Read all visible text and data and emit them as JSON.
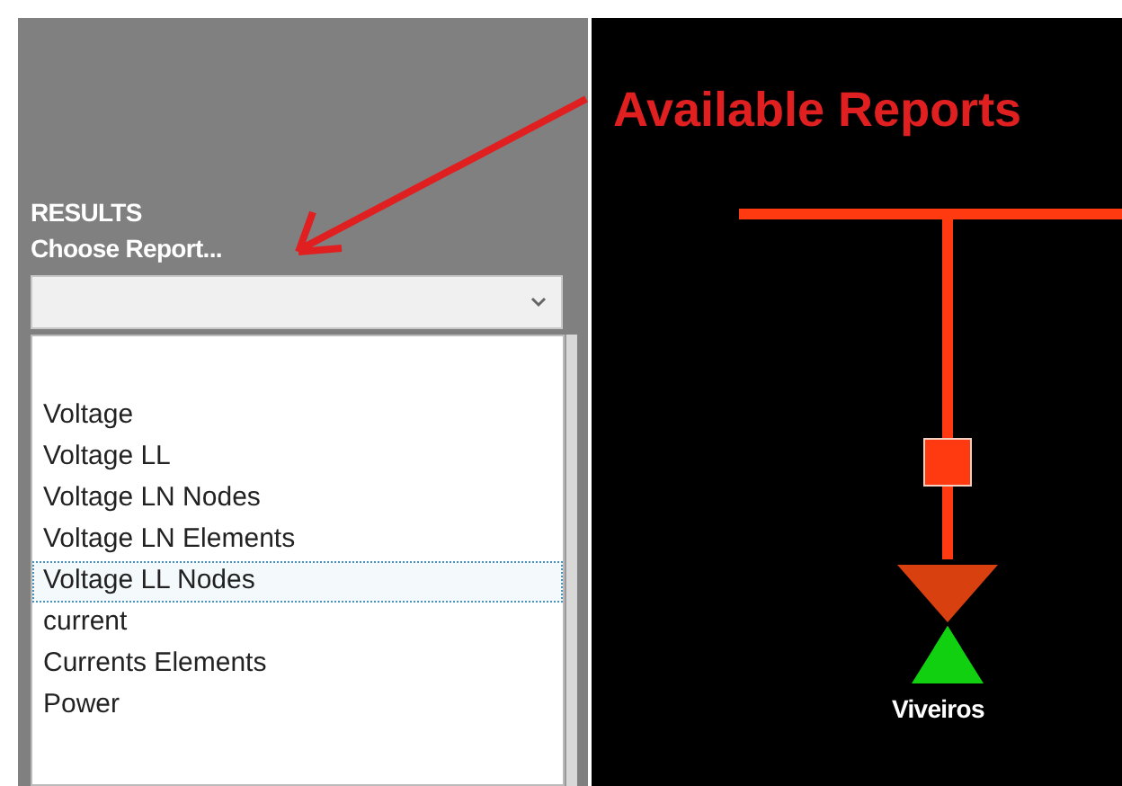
{
  "annotation": {
    "text": "Available Reports"
  },
  "results_panel": {
    "heading": "RESULTS",
    "label": "Choose Report...",
    "report_list": [
      {
        "label": "Voltage",
        "selected": false
      },
      {
        "label": "Voltage LL",
        "selected": false
      },
      {
        "label": "Voltage LN Nodes",
        "selected": false
      },
      {
        "label": "Voltage LN Elements",
        "selected": false
      },
      {
        "label": "Voltage LL Nodes",
        "selected": true
      },
      {
        "label": "current",
        "selected": false
      },
      {
        "label": "Currents Elements",
        "selected": false
      },
      {
        "label": "Power",
        "selected": false
      }
    ]
  },
  "diagram": {
    "node_label": "Viveiros"
  }
}
